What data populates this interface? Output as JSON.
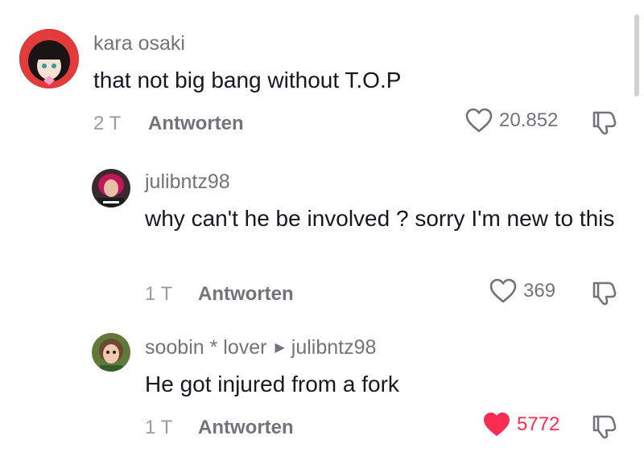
{
  "comments": [
    {
      "username": "kara osaki",
      "text": "that not big bang without T.O.P",
      "time": "2 T",
      "reply_label": "Antworten",
      "likes": "20.852",
      "liked": false
    },
    {
      "username": "julibntz98",
      "text": "why can't he be involved ? sorry I'm new to this",
      "time": "1 T",
      "reply_label": "Antworten",
      "likes": "369",
      "liked": false
    },
    {
      "username": "soobin * lover",
      "reply_to": "julibntz98",
      "text": "He got injured from a fork",
      "time": "1 T",
      "reply_label": "Antworten",
      "likes": "5772",
      "liked": true
    }
  ],
  "icons": {
    "like": "heart-icon",
    "dislike": "thumbs-down-icon",
    "reply_arrow": "triangle-right-icon"
  },
  "colors": {
    "liked_heart": "#fe2c55",
    "muted_text": "#73747b"
  }
}
